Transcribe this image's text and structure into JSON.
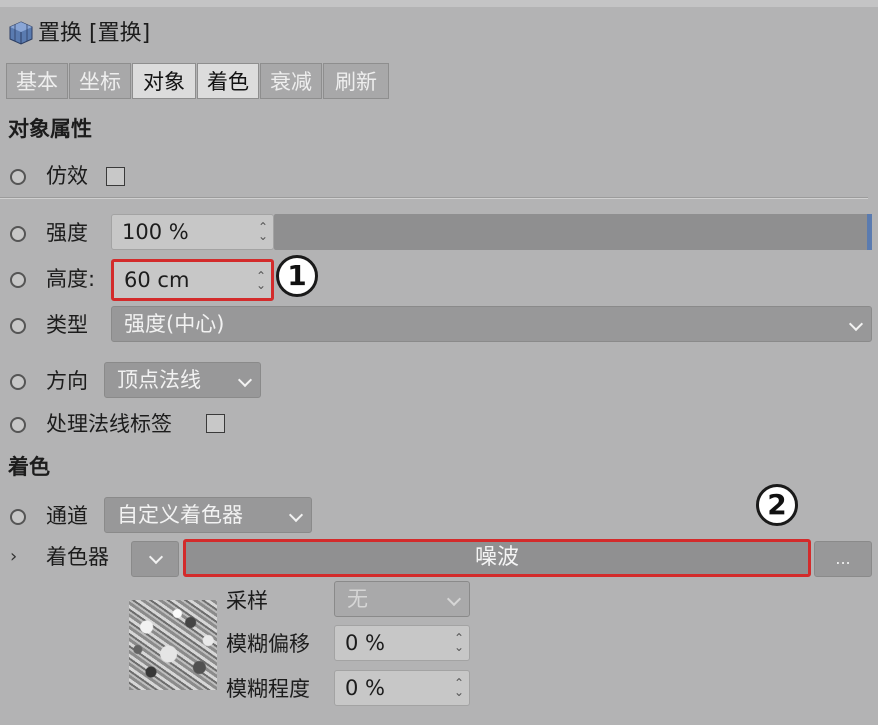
{
  "header": {
    "title": "置换 [置换]",
    "icon": "displacer-cube-icon"
  },
  "tabs": [
    {
      "label": "基本",
      "active": false
    },
    {
      "label": "坐标",
      "active": false
    },
    {
      "label": "对象",
      "active": true
    },
    {
      "label": "着色",
      "active": false
    },
    {
      "label": "衰减",
      "active": false
    },
    {
      "label": "刷新",
      "active": false
    }
  ],
  "object_props": {
    "title": "对象属性",
    "mimic": {
      "label": "仿效",
      "checked": false
    },
    "strength": {
      "label": "强度",
      "value": "100 %",
      "fill_percent": 100
    },
    "height": {
      "label": "高度:",
      "value": "60 cm"
    },
    "type": {
      "label": "类型",
      "value": "强度(中心)"
    },
    "direction": {
      "label": "方向",
      "value": "顶点法线"
    },
    "process_normal_tag": {
      "label": "处理法线标签",
      "checked": false
    }
  },
  "shading": {
    "title": "着色",
    "channel": {
      "label": "通道",
      "value": "自定义着色器"
    },
    "shader": {
      "label": "着色器",
      "value": "噪波",
      "more": "..."
    },
    "sampling": {
      "label": "采样",
      "value": "无"
    },
    "blur_offset": {
      "label": "模糊偏移",
      "value": "0 %"
    },
    "blur_scale": {
      "label": "模糊程度",
      "value": "0 %"
    }
  },
  "callouts": [
    "1",
    "2"
  ],
  "colors": {
    "highlight_red": "#d32b2b",
    "panel_bg": "#b3b3b4"
  }
}
